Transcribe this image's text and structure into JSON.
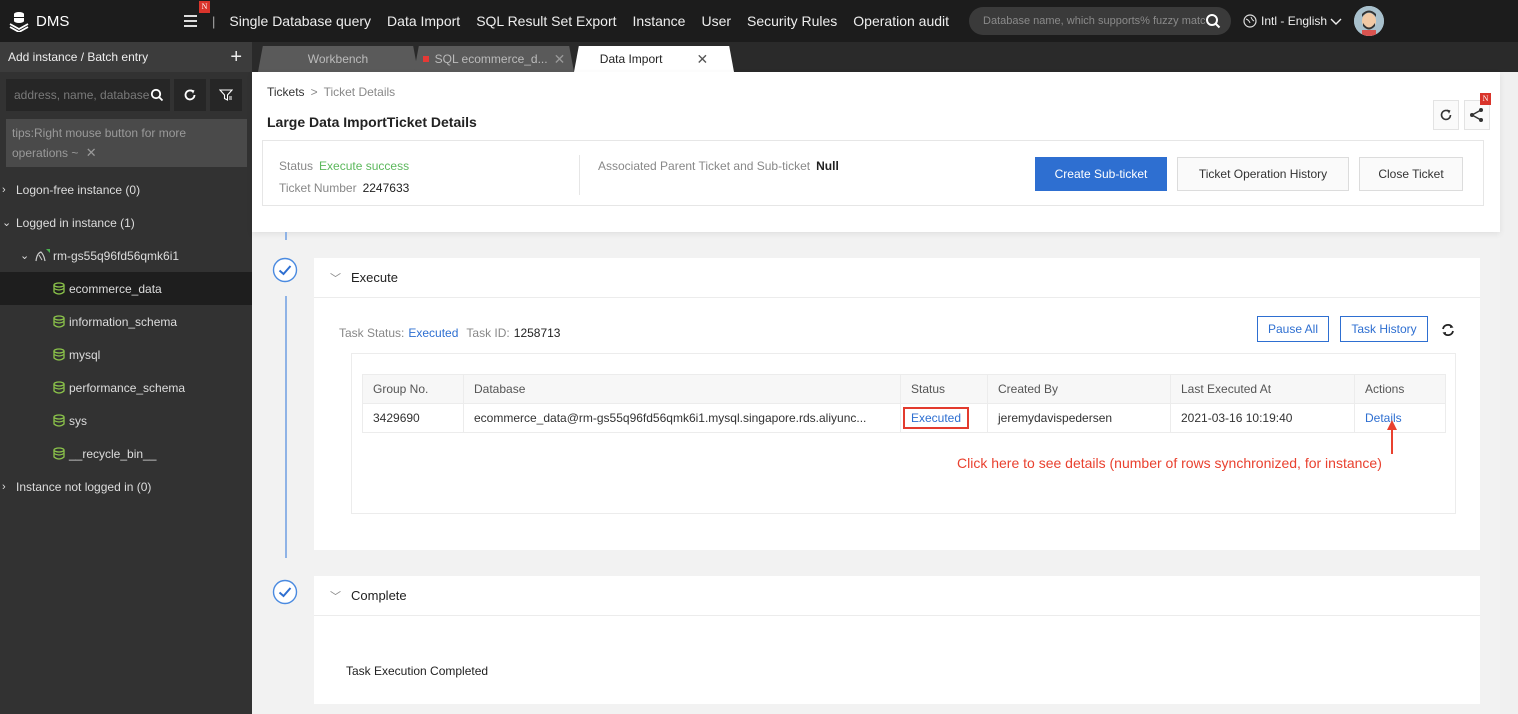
{
  "topbar": {
    "logo_text": "DMS",
    "menu_badge": "N",
    "separator": "|",
    "nav": [
      "Single Database query",
      "Data Import",
      "SQL Result Set Export",
      "Instance",
      "User",
      "Security Rules",
      "Operation audit"
    ],
    "search_placeholder": "Database name, which supports% fuzzy match",
    "language": "Intl - English"
  },
  "sidebar": {
    "header": "Add instance / Batch entry",
    "search_placeholder": "address, name, database",
    "tips": "tips:Right mouse button for more operations ~",
    "tree": {
      "logon_free": "Logon-free instance (0)",
      "logged_in": "Logged in instance (1)",
      "instance": "rm-gs55q96fd56qmk6i1",
      "databases": [
        "ecommerce_data",
        "information_schema",
        "mysql",
        "performance_schema",
        "sys",
        "__recycle_bin__"
      ],
      "selected_database": "ecommerce_data",
      "not_logged_in": "Instance not logged in (0)"
    }
  },
  "tabs": [
    {
      "label": "Workbench",
      "active": false
    },
    {
      "label": "SQL ecommerce_d...",
      "active": false,
      "unsaved": true
    },
    {
      "label": "Data Import",
      "active": true
    }
  ],
  "ticket": {
    "breadcrumb": [
      "Tickets",
      "Ticket Details"
    ],
    "title": "Large Data ImportTicket Details",
    "status_label": "Status",
    "status_value": "Execute success",
    "ticket_number_label": "Ticket Number",
    "ticket_number": "2247633",
    "assoc_label": "Associated Parent Ticket and Sub-ticket",
    "assoc_value": "Null",
    "buttons": {
      "create_sub": "Create Sub-ticket",
      "history": "Ticket Operation History",
      "close": "Close Ticket"
    },
    "share_badge": "N"
  },
  "execute": {
    "title": "Execute",
    "task_status_label": "Task Status:",
    "task_status": "Executed",
    "task_id_label": "Task ID:",
    "task_id": "1258713",
    "pause_all": "Pause All",
    "task_history": "Task History",
    "table": {
      "columns": [
        "Group No.",
        "Database",
        "Status",
        "Created By",
        "Last Executed At",
        "Actions"
      ],
      "rows": [
        {
          "group_no": "3429690",
          "database": "ecommerce_data@rm-gs55q96fd56qmk6i1.mysql.singapore.rds.aliyunc...",
          "status": "Executed",
          "created_by": "jeremydavispedersen",
          "last_executed_at": "2021-03-16 10:19:40",
          "action": "Details"
        }
      ]
    },
    "annotation": "Click here to see details (number of rows synchronized, for instance)"
  },
  "complete": {
    "title": "Complete",
    "message": "Task Execution Completed"
  },
  "colors": {
    "primary": "#2e6fd1",
    "success": "#5cb85c",
    "annotation": "#e9412f",
    "db_icon": "#8bc34a"
  }
}
